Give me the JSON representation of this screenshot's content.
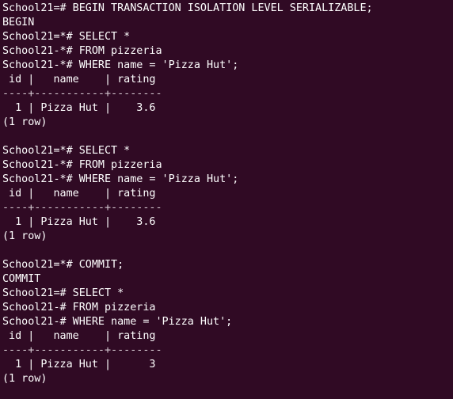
{
  "terminal": {
    "lines": [
      {
        "text": "School21=# BEGIN TRANSACTION ISOLATION LEVEL SERIALIZABLE;",
        "kind": "command"
      },
      {
        "text": "BEGIN",
        "kind": "output"
      },
      {
        "text": "School21=*# SELECT *",
        "kind": "command"
      },
      {
        "text": "School21-*# FROM pizzeria",
        "kind": "command"
      },
      {
        "text": "School21-*# WHERE name = 'Pizza Hut';",
        "kind": "command"
      },
      {
        "text": " id |   name    | rating",
        "kind": "table-header"
      },
      {
        "text": "----+-----------+--------",
        "kind": "table-separator"
      },
      {
        "text": "  1 | Pizza Hut |    3.6",
        "kind": "table-row"
      },
      {
        "text": "(1 row)",
        "kind": "output"
      },
      {
        "text": "",
        "kind": "blank"
      },
      {
        "text": "School21=*# SELECT *",
        "kind": "command"
      },
      {
        "text": "School21-*# FROM pizzeria",
        "kind": "command"
      },
      {
        "text": "School21-*# WHERE name = 'Pizza Hut';",
        "kind": "command"
      },
      {
        "text": " id |   name    | rating",
        "kind": "table-header"
      },
      {
        "text": "----+-----------+--------",
        "kind": "table-separator"
      },
      {
        "text": "  1 | Pizza Hut |    3.6",
        "kind": "table-row"
      },
      {
        "text": "(1 row)",
        "kind": "output"
      },
      {
        "text": "",
        "kind": "blank"
      },
      {
        "text": "School21=*# COMMIT;",
        "kind": "command"
      },
      {
        "text": "COMMIT",
        "kind": "output"
      },
      {
        "text": "School21=# SELECT *",
        "kind": "command"
      },
      {
        "text": "School21-# FROM pizzeria",
        "kind": "command"
      },
      {
        "text": "School21-# WHERE name = 'Pizza Hut';",
        "kind": "command"
      },
      {
        "text": " id |   name    | rating",
        "kind": "table-header"
      },
      {
        "text": "----+-----------+--------",
        "kind": "table-separator"
      },
      {
        "text": "  1 | Pizza Hut |      3",
        "kind": "table-row"
      },
      {
        "text": "(1 row)",
        "kind": "output"
      }
    ]
  },
  "colors": {
    "background": "#300a24",
    "foreground": "#ffffff"
  }
}
